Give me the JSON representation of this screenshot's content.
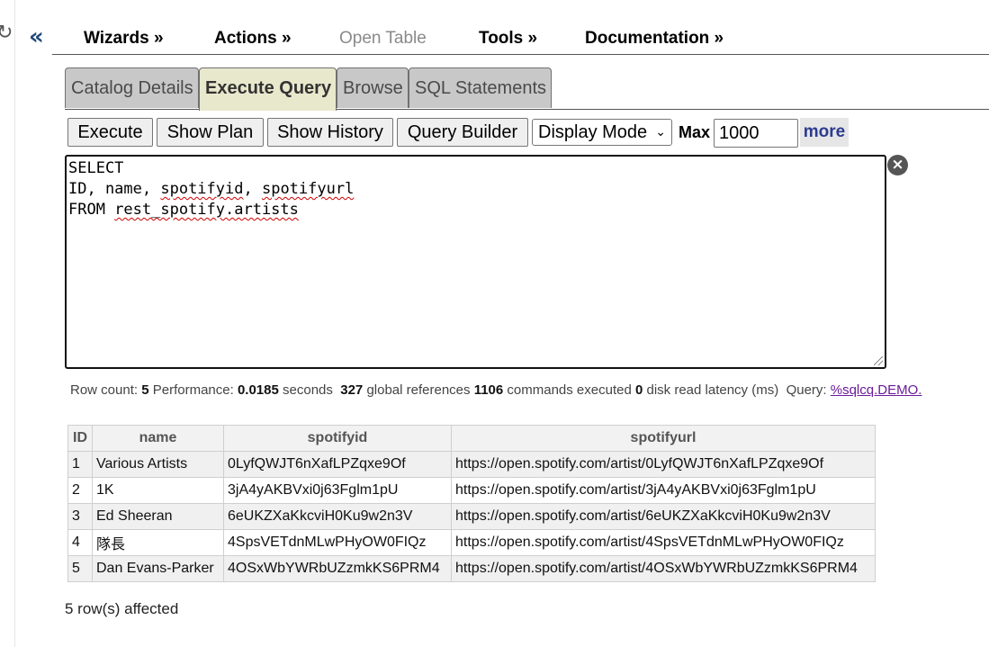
{
  "nav": {
    "refresh_glyph": "↻",
    "collapse_glyph": "«",
    "menu": [
      {
        "label": "Wizards »",
        "enabled": true
      },
      {
        "label": "Actions »",
        "enabled": true
      },
      {
        "label": "Open Table",
        "enabled": false
      },
      {
        "label": "Tools »",
        "enabled": true
      },
      {
        "label": "Documentation »",
        "enabled": true
      }
    ]
  },
  "tabs": [
    {
      "label": "Catalog Details",
      "active": false
    },
    {
      "label": "Execute Query",
      "active": true
    },
    {
      "label": "Browse",
      "active": false
    },
    {
      "label": "SQL Statements",
      "active": false
    }
  ],
  "toolbar": {
    "execute_label": "Execute",
    "show_plan_label": "Show Plan",
    "show_history_label": "Show History",
    "query_builder_label": "Query Builder",
    "display_mode_value": "Display Mode",
    "max_label": "Max",
    "max_value": "1000",
    "more_label": "more"
  },
  "query": {
    "line1": "SELECT",
    "line2_plain": "ID, name, ",
    "line2_word1": "spotifyid",
    "line2_sep": ", ",
    "line2_word2": "spotifyurl",
    "line3_plain": "FROM ",
    "line3_word": "rest_spotify.artists"
  },
  "stats": {
    "row_count_label": "Row count:",
    "row_count": "5",
    "performance_label": "Performance:",
    "seconds": "0.0185",
    "seconds_label": "seconds",
    "global_refs": "327",
    "global_refs_label": "global references",
    "commands": "1106",
    "commands_label": "commands executed",
    "disk_latency": "0",
    "disk_latency_label": "disk read latency (ms)",
    "query_label": "Query:",
    "query_link": "%sqlcq.DEMO."
  },
  "table": {
    "columns": [
      "ID",
      "name",
      "spotifyid",
      "spotifyurl"
    ],
    "rows": [
      [
        "1",
        "Various Artists",
        "0LyfQWJT6nXafLPZqxe9Of",
        "https://open.spotify.com/artist/0LyfQWJT6nXafLPZqxe9Of"
      ],
      [
        "2",
        "1K",
        "3jA4yAKBVxi0j63Fglm1pU",
        "https://open.spotify.com/artist/3jA4yAKBVxi0j63Fglm1pU"
      ],
      [
        "3",
        "Ed Sheeran",
        "6eUKZXaKkcviH0Ku9w2n3V",
        "https://open.spotify.com/artist/6eUKZXaKkcviH0Ku9w2n3V"
      ],
      [
        "4",
        "隊長",
        "4SpsVETdnMLwPHyOW0FIQz",
        "https://open.spotify.com/artist/4SpsVETdnMLwPHyOW0FIQz"
      ],
      [
        "5",
        "Dan Evans-Parker",
        "4OSxWbYWRbUZzmkKS6PRM4",
        "https://open.spotify.com/artist/4OSxWbYWRbUZzmkKS6PRM4"
      ]
    ]
  },
  "footer": {
    "affected": "5 row(s) affected"
  }
}
